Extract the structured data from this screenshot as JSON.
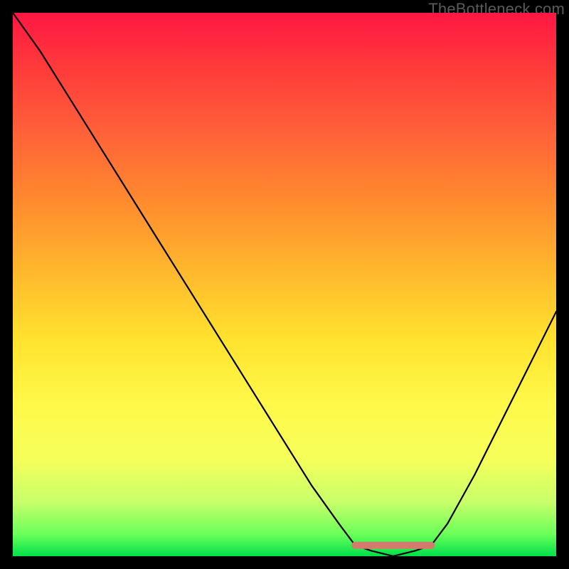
{
  "watermark": "TheBottleneck.com",
  "chart_data": {
    "type": "line",
    "title": "",
    "xlabel": "",
    "ylabel": "",
    "xlim": [
      0,
      1
    ],
    "ylim": [
      0,
      1
    ],
    "grid": false,
    "legend": false,
    "note": "Axes are unlabeled; values are normalized 0–1 by pixel position. y = bottleneck magnitude (1 = max red, 0 = min green). The black curve dips to ~0 near x≈0.70 (sweet spot) and rises on both sides.",
    "annotations": [
      {
        "text": "short salmon bar at bottom denoting sweet-spot range",
        "x_range": [
          0.63,
          0.77
        ],
        "y": 0.02
      }
    ],
    "series": [
      {
        "name": "bottleneck-curve",
        "color": "#000000",
        "x": [
          0.0,
          0.05,
          0.1,
          0.15,
          0.2,
          0.25,
          0.3,
          0.35,
          0.4,
          0.45,
          0.5,
          0.55,
          0.6,
          0.63,
          0.66,
          0.7,
          0.74,
          0.77,
          0.8,
          0.85,
          0.9,
          0.95,
          1.0
        ],
        "y": [
          1.0,
          0.93,
          0.85,
          0.77,
          0.69,
          0.61,
          0.53,
          0.45,
          0.37,
          0.29,
          0.21,
          0.13,
          0.06,
          0.02,
          0.01,
          0.0,
          0.01,
          0.02,
          0.06,
          0.15,
          0.25,
          0.35,
          0.45
        ]
      },
      {
        "name": "sweet-spot-marker",
        "color": "#d77a6e",
        "x": [
          0.63,
          0.77
        ],
        "y": [
          0.02,
          0.02
        ]
      }
    ]
  }
}
